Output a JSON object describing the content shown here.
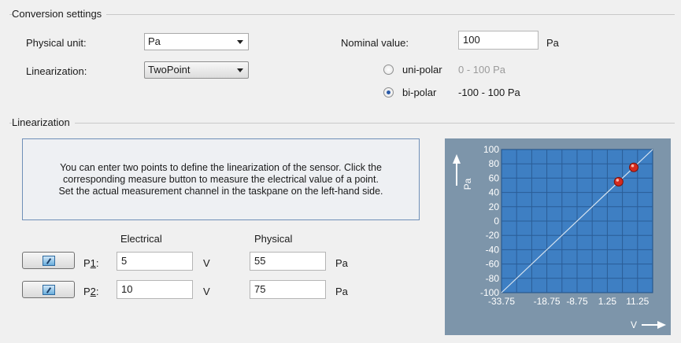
{
  "conversion": {
    "title": "Conversion settings",
    "physical_unit_label": "Physical unit:",
    "physical_unit_value": "Pa",
    "linearization_label": "Linearization:",
    "linearization_value": "TwoPoint",
    "nominal_label": "Nominal value:",
    "nominal_value": "100",
    "nominal_unit": "Pa",
    "unipolar_label": "uni-polar",
    "unipolar_range": "0 - 100 Pa",
    "bipolar_label": "bi-polar",
    "bipolar_range": "-100 - 100 Pa",
    "selected_polarity": "bi-polar"
  },
  "linearization": {
    "title": "Linearization",
    "info_line1": "You can enter two points to define the linearization of the sensor. Click the",
    "info_line2": "corresponding measure button to measure the electrical value of a point.",
    "info_line3": "Set the actual measurement channel in the taskpane on the left-hand side.",
    "electrical_header": "Electrical",
    "physical_header": "Physical",
    "points": [
      {
        "label_prefix": "P",
        "label_num": "1",
        "label_suffix": ":",
        "electrical": "5",
        "electrical_unit": "V",
        "physical": "55",
        "physical_unit": "Pa"
      },
      {
        "label_prefix": "P",
        "label_num": "2",
        "label_suffix": ":",
        "electrical": "10",
        "electrical_unit": "V",
        "physical": "75",
        "physical_unit": "Pa"
      }
    ]
  },
  "chart_data": {
    "type": "line",
    "xlabel": "V",
    "ylabel": "Pa",
    "x_tick_labels": [
      "-33.75",
      "-18.75",
      "-8.75",
      "1.25",
      "11.25"
    ],
    "y_tick_labels": [
      "100",
      "80",
      "60",
      "40",
      "20",
      "0",
      "-20",
      "-40",
      "-60",
      "-80",
      "-100"
    ],
    "ylim": [
      -100,
      100
    ],
    "xlim": [
      -33.75,
      16.25
    ],
    "grid": true,
    "line": {
      "x": [
        -33.75,
        16.25
      ],
      "y": [
        -100,
        100
      ]
    },
    "points": [
      {
        "x": 5,
        "y": 55
      },
      {
        "x": 10,
        "y": 75
      }
    ],
    "colors": {
      "background": "#7d95aa",
      "plot": "#3e7fc3",
      "grid": "#2a5d96",
      "line": "#d8e4f0",
      "point": "#d42a1e"
    }
  }
}
